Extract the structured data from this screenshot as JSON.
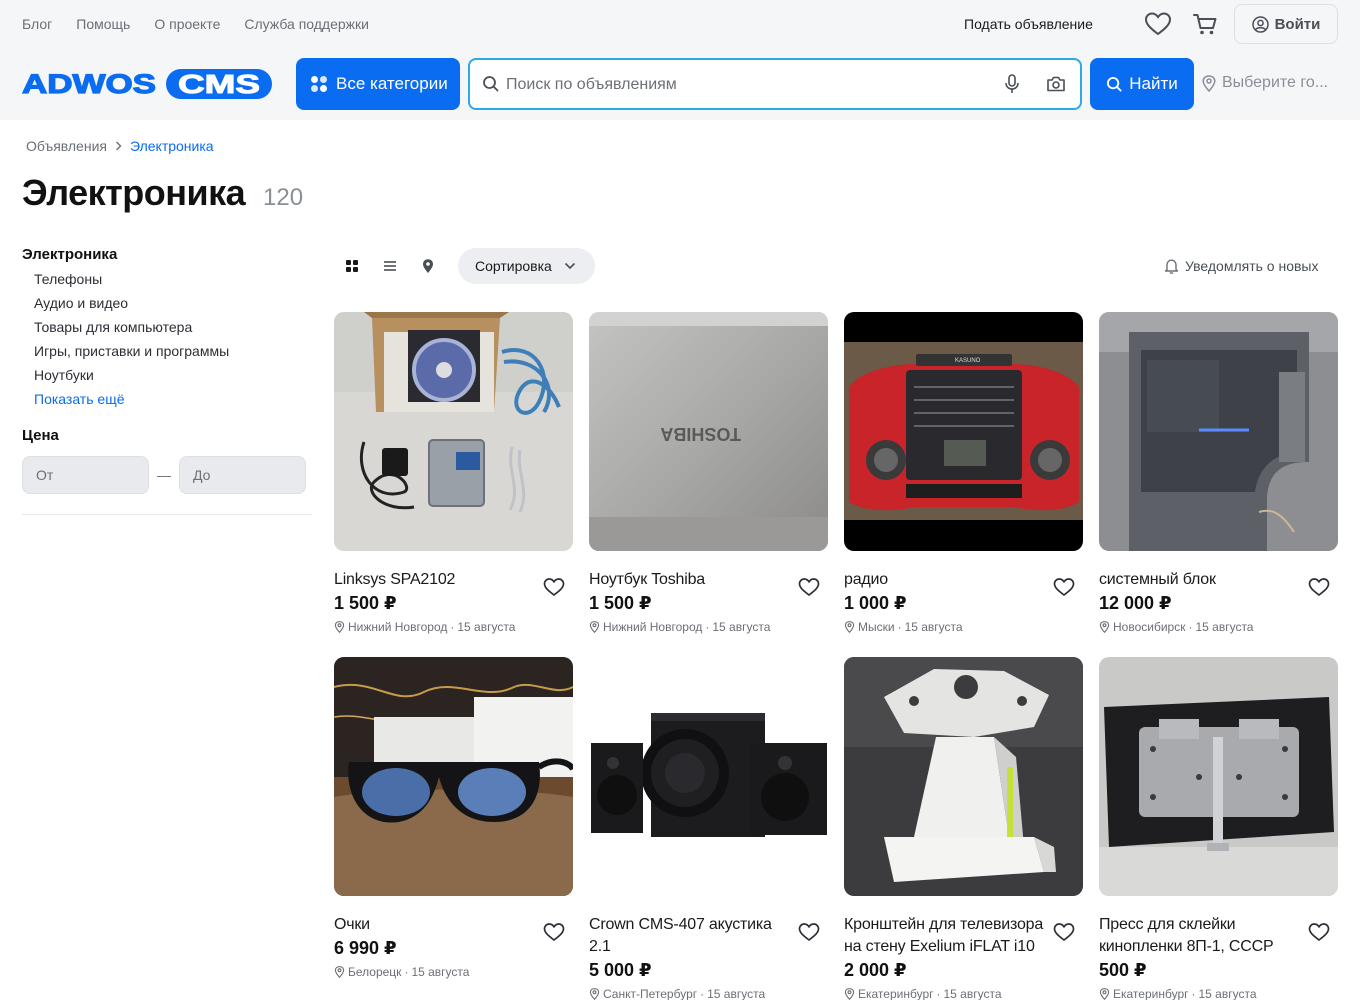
{
  "header": {
    "top_links": [
      "Блог",
      "Помощь",
      "О проекте",
      "Служба поддержки"
    ],
    "post_ad_label": "Подать объявление",
    "login_label": "Войти",
    "logo_text": "ADWOS",
    "logo_badge": "CMS",
    "categories_label": "Все категории",
    "search_placeholder": "Поиск по объявлениям",
    "find_label": "Найти",
    "city_label": "Выберите го...",
    "brand_color": "#0a6cf0"
  },
  "breadcrumb": {
    "root": "Объявления",
    "current": "Электроника"
  },
  "page": {
    "title": "Электроника",
    "count": "120"
  },
  "sidebar": {
    "heading": "Электроника",
    "items": [
      "Телефоны",
      "Аудио и видео",
      "Товары для компьютера",
      "Игры, приставки и программы",
      "Ноутбуки"
    ],
    "show_more": "Показать ещё",
    "price_heading": "Цена",
    "price_from_placeholder": "От",
    "price_to_placeholder": "До",
    "price_dash": "—"
  },
  "toolbar": {
    "sort_label": "Сортировка",
    "notify_label": "Уведомлять о новых"
  },
  "listings": [
    {
      "title": "Linksys SPA2102",
      "price": "1 500 ₽",
      "city": "Нижний Новгород",
      "date": "15 августа"
    },
    {
      "title": "Ноутбук Toshiba",
      "price": "1 500 ₽",
      "city": "Нижний Новгород",
      "date": "15 августа"
    },
    {
      "title": "радио",
      "price": "1 000 ₽",
      "city": "Мыски",
      "date": "15 августа"
    },
    {
      "title": "системный блок",
      "price": "12 000 ₽",
      "city": "Новосибирск",
      "date": "15 августа"
    },
    {
      "title": "Очки",
      "price": "6 990 ₽",
      "city": "Белорецк",
      "date": "15 августа"
    },
    {
      "title": "Crown CMS-407 акустика 2.1",
      "price": "5 000 ₽",
      "city": "Санкт-Петербург",
      "date": "15 августа"
    },
    {
      "title": "Кронштейн для телевизора на стену Exelium iFLAT i10",
      "price": "2 000 ₽",
      "city": "Екатеринбург",
      "date": "15 августа"
    },
    {
      "title": "Пресс для склейки кинопленки 8П-1, СССР",
      "price": "500 ₽",
      "city": "Екатеринбург",
      "date": "15 августа"
    }
  ],
  "photo_texts": {
    "toshiba_mark": "TOSHIBA",
    "radio_brand": "KASUNO"
  }
}
